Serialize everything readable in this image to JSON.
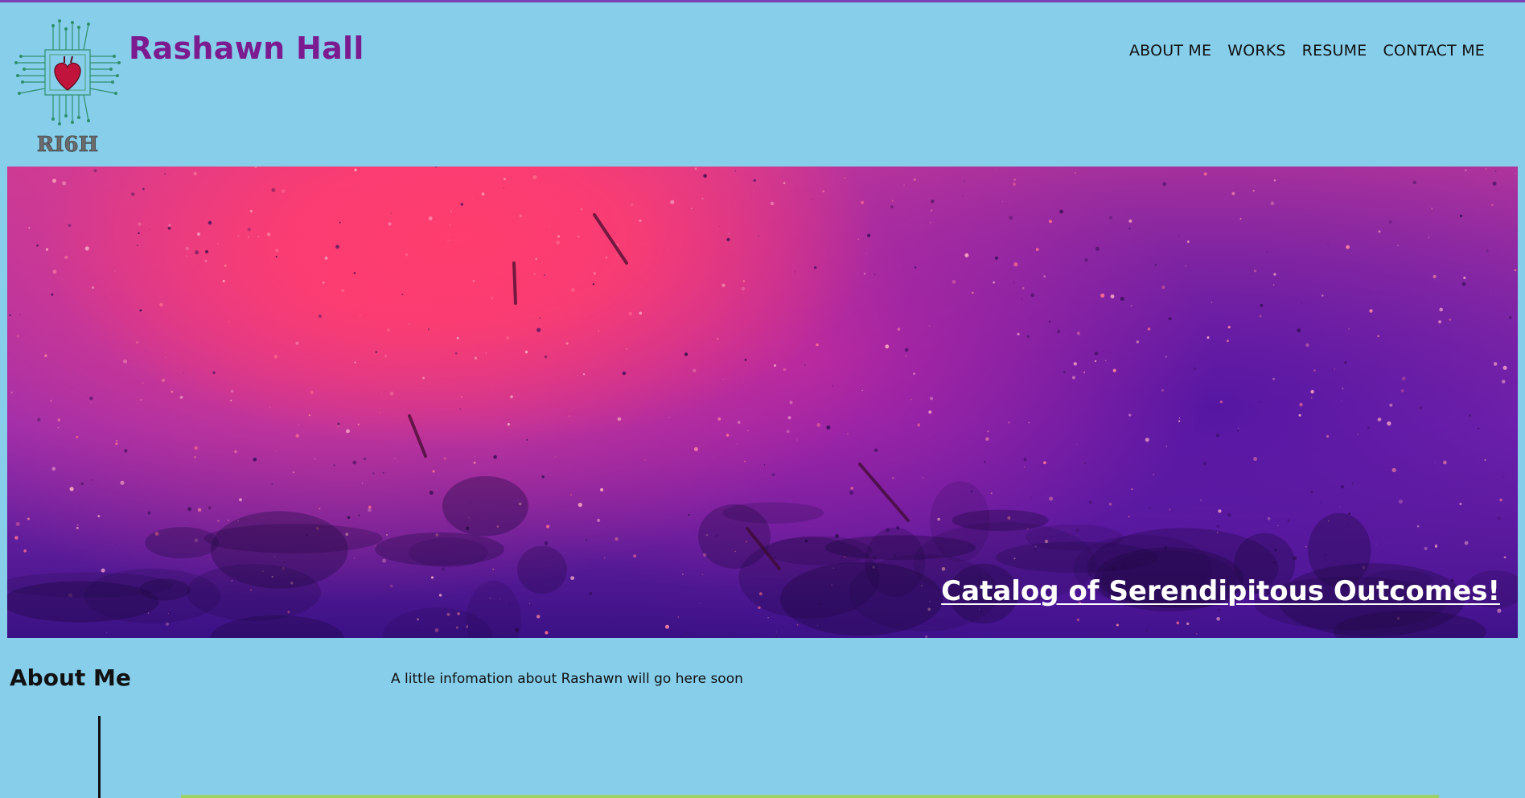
{
  "site": {
    "title": "Rashawn Hall",
    "logo_text": "RI6H"
  },
  "nav": {
    "items": [
      "ABOUT ME",
      "WORKS",
      "RESUME",
      "CONTACT ME"
    ]
  },
  "hero": {
    "caption": "Catalog of Serendipitous Outcomes!"
  },
  "about": {
    "heading": "About Me",
    "text": "A little infomation about Rashawn will go here soon"
  },
  "colors": {
    "background": "#87ceeb",
    "title": "#7b1b8f",
    "top_rule": "#7a3fb5",
    "accent_rule": "#9bd06a",
    "logo_heart": "#c0143c",
    "logo_circuit": "#2f8f6b"
  },
  "icons": {
    "logo": "heart-circuit-logo-icon"
  }
}
